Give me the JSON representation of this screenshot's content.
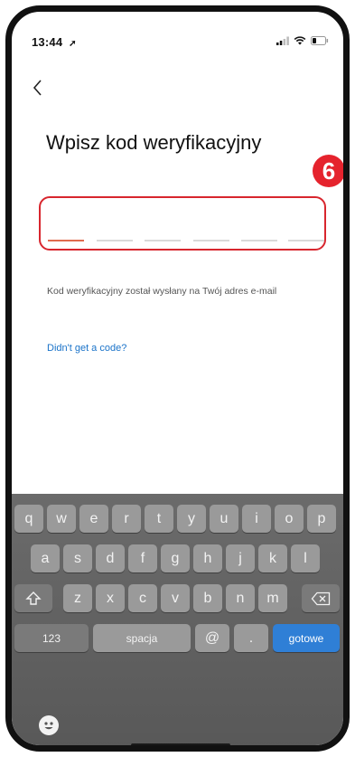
{
  "status_bar": {
    "time": "13:44",
    "location_arrow": "location-arrow-icon",
    "icons": [
      "cellular-signal-icon",
      "wifi-icon",
      "battery-icon"
    ]
  },
  "nav": {
    "back_icon": "chevron-left-icon"
  },
  "page": {
    "title": "Wpisz kod weryfikacyjny",
    "step_badge": "6",
    "code_slots": 6,
    "hint": "Kod weryfikacyjny został wysłany na Twój adres e-mail",
    "resend_link": "Didn't get a code?"
  },
  "keyboard": {
    "row1": [
      "q",
      "w",
      "e",
      "r",
      "t",
      "y",
      "u",
      "i",
      "o",
      "p"
    ],
    "row2": [
      "a",
      "s",
      "d",
      "f",
      "g",
      "h",
      "j",
      "k",
      "l"
    ],
    "row3": [
      "z",
      "x",
      "c",
      "v",
      "b",
      "n",
      "m"
    ],
    "shift_icon": "shift-arrow-icon",
    "delete_icon": "backspace-icon",
    "numbers_key": "123",
    "space_key": "spacja",
    "at_key": "@",
    "dot_key": ".",
    "done_key": "gotowe",
    "emoji_icon": "emoji-face-icon"
  },
  "colors": {
    "accent_red": "#e5232d",
    "link_blue": "#1a73c9",
    "done_blue": "#2f7fd6"
  }
}
